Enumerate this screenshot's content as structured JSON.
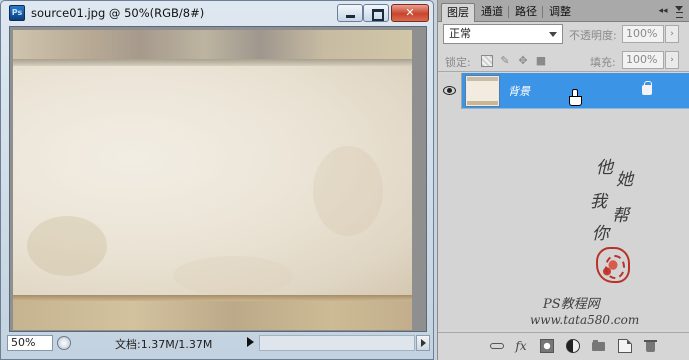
{
  "document": {
    "title": "source01.jpg @ 50%(RGB/8#)",
    "app_icon_label": "Ps",
    "zoom": "50%",
    "doc_info": "文档:1.37M/1.37M"
  },
  "panel": {
    "tabs": [
      {
        "label": "图层",
        "active": true
      },
      {
        "label": "通道",
        "active": false
      },
      {
        "label": "路径",
        "active": false
      },
      {
        "label": "调整",
        "active": false
      }
    ],
    "collapse_glyph": "◂◂",
    "blend_mode": "正常",
    "opacity_label": "不透明度:",
    "opacity_value": "100%",
    "lock_label": "锁定:",
    "fill_label": "填充:",
    "fill_value": "100%",
    "arrow_glyph": "›",
    "fx_label": "fx"
  },
  "layers": [
    {
      "name": "背景",
      "visible": true,
      "locked": true,
      "selected": true
    }
  ],
  "watermark": {
    "chars": [
      "他",
      "她",
      "我",
      "帮",
      "你"
    ],
    "site": "PS教程网",
    "url": "www.tata580.com"
  },
  "colors": {
    "selection_blue": "#3c94e6",
    "seal_red": "#b8322a"
  }
}
